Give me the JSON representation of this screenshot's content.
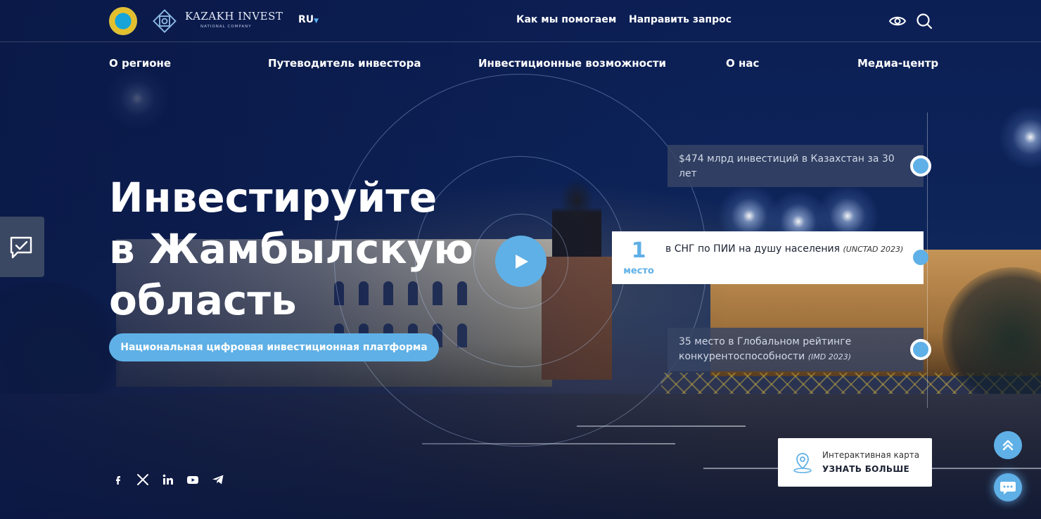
{
  "header": {
    "logo_text": "KAZAKH INVEST",
    "logo_subtitle": "NATIONAL COMPANY",
    "language": "RU",
    "links": [
      "Как мы помогаем",
      "Направить запрос"
    ]
  },
  "nav": {
    "items": [
      "О регионе",
      "Путеводитель инвестора",
      "Инвестиционные возможности",
      "О нас",
      "Медиа-центр"
    ]
  },
  "hero": {
    "title": "Инвестируйте в Жамбылскую область",
    "cta_label": "Национальная цифровая инвестиционная платформа"
  },
  "stats": {
    "card1": {
      "text": "$474 млрд инвестиций в Казахстан за 30 лет"
    },
    "card2": {
      "number": "1",
      "unit": "место",
      "text": "в СНГ по ПИИ на душу населения",
      "source": "(UNCTAD 2023)"
    },
    "card3": {
      "text": "35 место в Глобальном рейтинге конкурентоспособности",
      "source": "(IMD 2023)"
    }
  },
  "map_card": {
    "label": "Интерактивная карта",
    "action": "УЗНАТЬ БОЛЬШЕ"
  },
  "socials": [
    "facebook-icon",
    "x-icon",
    "linkedin-icon",
    "youtube-icon",
    "telegram-icon"
  ],
  "colors": {
    "accent": "#5fb0e6",
    "background": "#0b1d4a"
  }
}
